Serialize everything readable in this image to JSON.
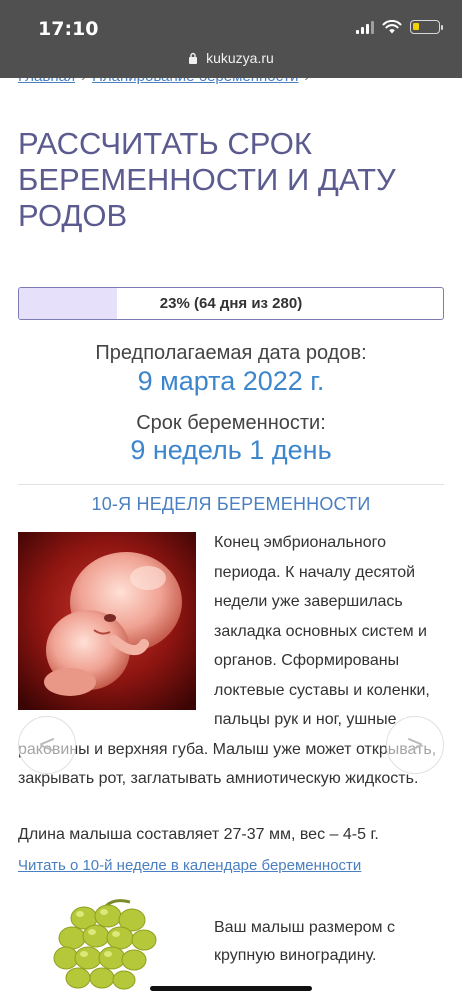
{
  "status_bar": {
    "time": "17:10"
  },
  "browser": {
    "url": "kukuzya.ru"
  },
  "breadcrumb": {
    "items": [
      "Главная",
      "Планирование беременности"
    ],
    "separator": "›"
  },
  "page": {
    "title": "РАССЧИТАТЬ СРОК БЕРЕМЕННОСТИ И ДАТУ РОДОВ"
  },
  "progress": {
    "percent": 23,
    "text": "23% (64 дня из 280)"
  },
  "result": {
    "due_label": "Предполагаемая дата родов:",
    "due_value": "9 марта 2022 г.",
    "term_label": "Срок беременности:",
    "term_value": "9 недель 1 день"
  },
  "week": {
    "heading": "10-Я НЕДЕЛЯ БЕРЕМЕННОСТИ",
    "description": "Конец эмбрионального периода. К началу десятой недели уже завершилась закладка основных систем и органов. Сформированы локтевые суставы и коленки, пальцы рук и ног, ушные раковины и верхняя губа. Малыш уже может открывать, закрывать рот, заглатывать амниотическую жидкость.",
    "size": "Длина малыша составляет 27-37 мм, вес – 4-5 г.",
    "link": "Читать о 10-й неделе в календаре беременности",
    "prev_arrow": "<",
    "next_arrow": ">"
  },
  "fruit": {
    "text": "Ваш малыш размером с крупную виноградину."
  },
  "colors": {
    "topbar": "#505050",
    "title": "#5b5b8f",
    "link": "#4a7fc1",
    "value": "#3d86cc",
    "progress_fill": "#e6e0fa",
    "progress_border": "#7d7bb5"
  }
}
